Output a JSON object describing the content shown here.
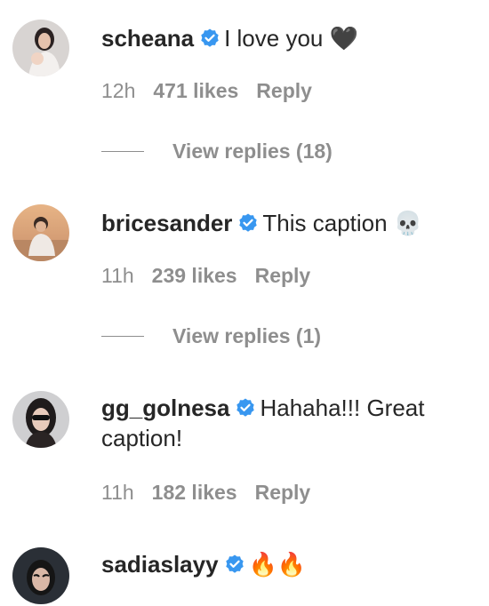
{
  "colors": {
    "text": "#262626",
    "secondary": "#8e8e8e",
    "verified_badge": "#3897f0",
    "fire": "#ff6a00"
  },
  "comments": [
    {
      "username": "scheana",
      "verified": true,
      "text": "I love you",
      "emoji": "🖤",
      "time": "12h",
      "likes": "471 likes",
      "reply_label": "Reply",
      "view_replies": "View replies (18)"
    },
    {
      "username": "bricesander",
      "verified": true,
      "text": "This caption",
      "emoji": "💀",
      "time": "11h",
      "likes": "239 likes",
      "reply_label": "Reply",
      "view_replies": "View replies (1)"
    },
    {
      "username": "gg_golnesa",
      "verified": true,
      "text": "Hahaha!!! Great caption!",
      "time": "11h",
      "likes": "182 likes",
      "reply_label": "Reply"
    },
    {
      "username": "sadiaslayy",
      "verified": true,
      "emoji": "🔥🔥"
    }
  ]
}
